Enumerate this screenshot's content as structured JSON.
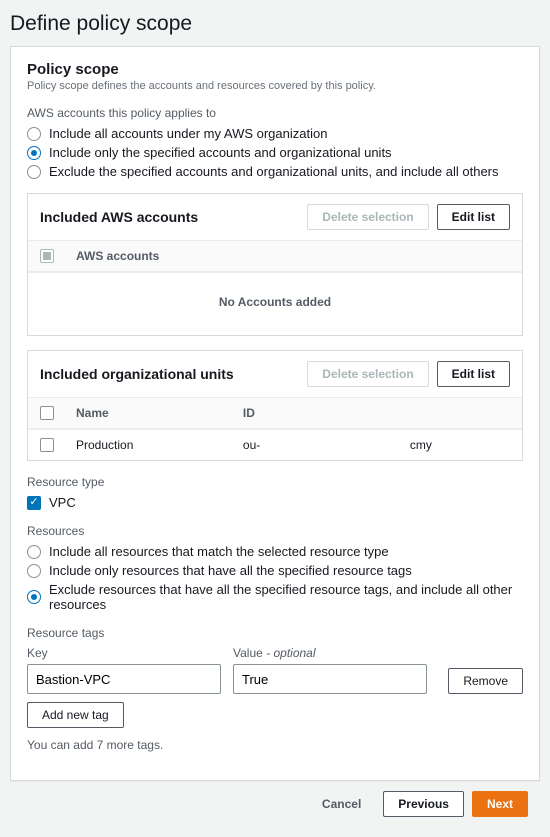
{
  "page": {
    "title": "Define policy scope"
  },
  "panel": {
    "title": "Policy scope",
    "desc": "Policy scope defines the accounts and resources covered by this policy."
  },
  "accounts": {
    "label": "AWS accounts this policy applies to",
    "options": {
      "all": "Include all accounts under my AWS organization",
      "only": "Include only the specified accounts and organizational units",
      "exclude": "Exclude the specified accounts and organizational units, and include all others"
    }
  },
  "includedAccounts": {
    "title": "Included AWS accounts",
    "deleteBtn": "Delete selection",
    "editBtn": "Edit list",
    "col1": "AWS accounts",
    "empty": "No Accounts added"
  },
  "includedOUs": {
    "title": "Included organizational units",
    "deleteBtn": "Delete selection",
    "editBtn": "Edit list",
    "colName": "Name",
    "colId": "ID",
    "row": {
      "name": "Production",
      "idPrefix": "ou-",
      "idSuffix": "cmy"
    }
  },
  "resourceType": {
    "label": "Resource type",
    "vpc": "VPC"
  },
  "resources": {
    "label": "Resources",
    "options": {
      "all": "Include all resources that match the selected resource type",
      "only": "Include only resources that have all the specified resource tags",
      "exclude": "Exclude resources that have all the specified resource tags, and include all other resources"
    }
  },
  "tags": {
    "label": "Resource tags",
    "keyLabel": "Key",
    "valueLabel": "Value",
    "valueOptional": " - optional",
    "keyValue": "Bastion-VPC",
    "valueValue": "True",
    "removeBtn": "Remove",
    "addBtn": "Add new tag",
    "hint": "You can add 7 more tags."
  },
  "footer": {
    "cancel": "Cancel",
    "previous": "Previous",
    "next": "Next"
  }
}
